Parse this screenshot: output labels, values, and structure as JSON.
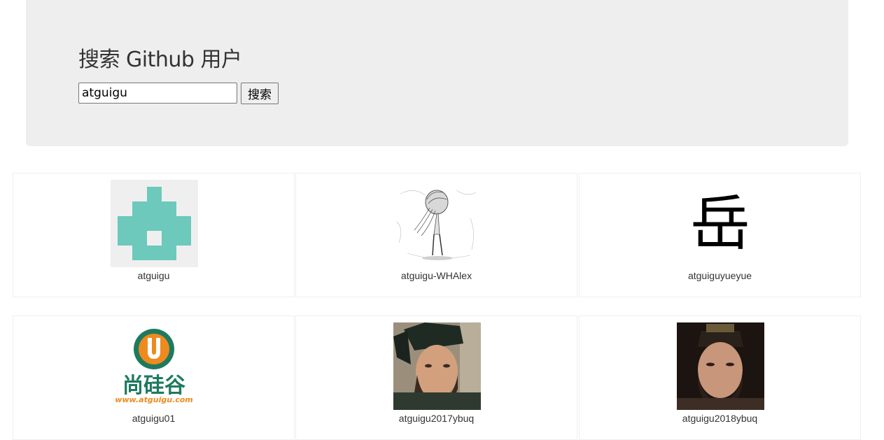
{
  "header": {
    "title": "搜索 Github 用户",
    "search": {
      "value": "atguigu",
      "button_label": "搜索"
    }
  },
  "users": [
    {
      "login": "atguigu",
      "avatar_icon": "identicon-avatar",
      "avatar_color": "#6cc9bb"
    },
    {
      "login": "atguigu-WHAlex",
      "avatar_icon": "sketch-girl-avatar"
    },
    {
      "login": "atguiguyueyue",
      "avatar_icon": "yue-character-avatar",
      "avatar_text": "岳"
    },
    {
      "login": "atguigu01",
      "avatar_icon": "atguigu-logo-avatar",
      "avatar_text": "尚硅谷",
      "avatar_subtext": "www.atguigu.com",
      "brand_green": "#1e7a5e",
      "brand_orange": "#ef8a1e"
    },
    {
      "login": "atguigu2017ybuq",
      "avatar_icon": "portrait-photo-avatar"
    },
    {
      "login": "atguigu2018ybuq",
      "avatar_icon": "portrait-photo-avatar"
    }
  ]
}
